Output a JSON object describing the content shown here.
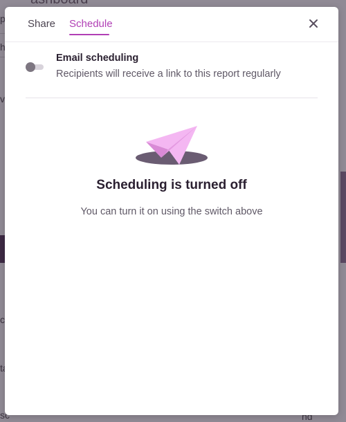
{
  "background": {
    "title_fragment": "ashboard",
    "fragments": [
      "p",
      "hi",
      "vs",
      "c",
      "ta",
      "sc",
      "nd"
    ]
  },
  "modal": {
    "tabs": [
      {
        "label": "Share",
        "active": false
      },
      {
        "label": "Schedule",
        "active": true
      }
    ],
    "close_icon": "close-icon",
    "email_scheduling": {
      "title": "Email scheduling",
      "description": "Recipients will receive a link to this report regularly",
      "enabled": false
    },
    "empty_state": {
      "illustration": "paper-plane-icon",
      "title": "Scheduling is turned off",
      "subtitle": "You can turn it on using the switch above"
    }
  },
  "colors": {
    "accent": "#b13fb5",
    "overlay": "#908a95",
    "plane_light": "#f4b7f2",
    "plane_dark": "#d98ad6",
    "shadow": "#6a5c72"
  }
}
